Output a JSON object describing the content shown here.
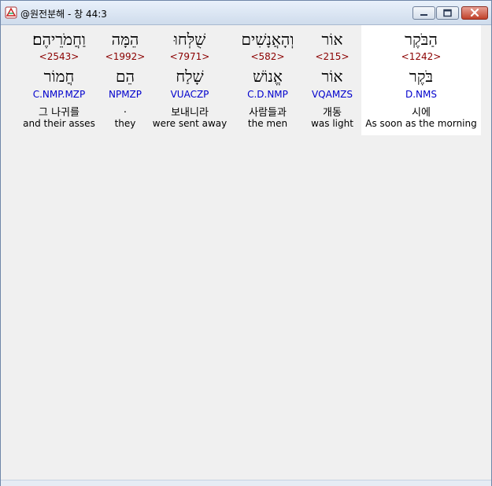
{
  "window": {
    "title": "@원전분해 - 창 44:3",
    "minimize_glyph": "",
    "maximize_glyph": "",
    "close_glyph": "✕",
    "icon": "app-icon"
  },
  "colors": {
    "strong_number": "#8b0000",
    "parsing": "#0000cd",
    "highlight_bg": "#ffffff"
  },
  "words": [
    {
      "hebrew": "הַבֹּקֶר",
      "strong": "<1242>",
      "root": "בֹּקֶר",
      "parsing": "D.NMS",
      "korean": "시에",
      "english": "As soon as the morning",
      "selected": true
    },
    {
      "hebrew": "אוֹר",
      "strong": "<215>",
      "root": "אוֹר",
      "parsing": "VQAMZS",
      "korean": "개동",
      "english": "was light",
      "selected": false
    },
    {
      "hebrew": "וְהָאֲנָשִׁים",
      "strong": "<582>",
      "root": "אֱנוֹשׁ",
      "parsing": "C.D.NMP",
      "korean": "사람들과",
      "english": "the men",
      "selected": false
    },
    {
      "hebrew": "שֻׁלְּחוּ",
      "strong": "<7971>",
      "root": "שָׁלַח",
      "parsing": "VUACZP",
      "korean": "보내니라",
      "english": "were sent away",
      "selected": false
    },
    {
      "hebrew": "הֵמָּה",
      "strong": "<1992>",
      "root": "הֵם",
      "parsing": "NPMZP",
      "korean": ".",
      "english": "they",
      "selected": false
    },
    {
      "hebrew": "וַחֲמֹרֵיהֶם׃",
      "strong": "<2543>",
      "root": "חֲמוֹר",
      "parsing": "C.NMP.MZP",
      "korean": "그 나귀를",
      "english": "and their asses",
      "selected": false
    }
  ]
}
